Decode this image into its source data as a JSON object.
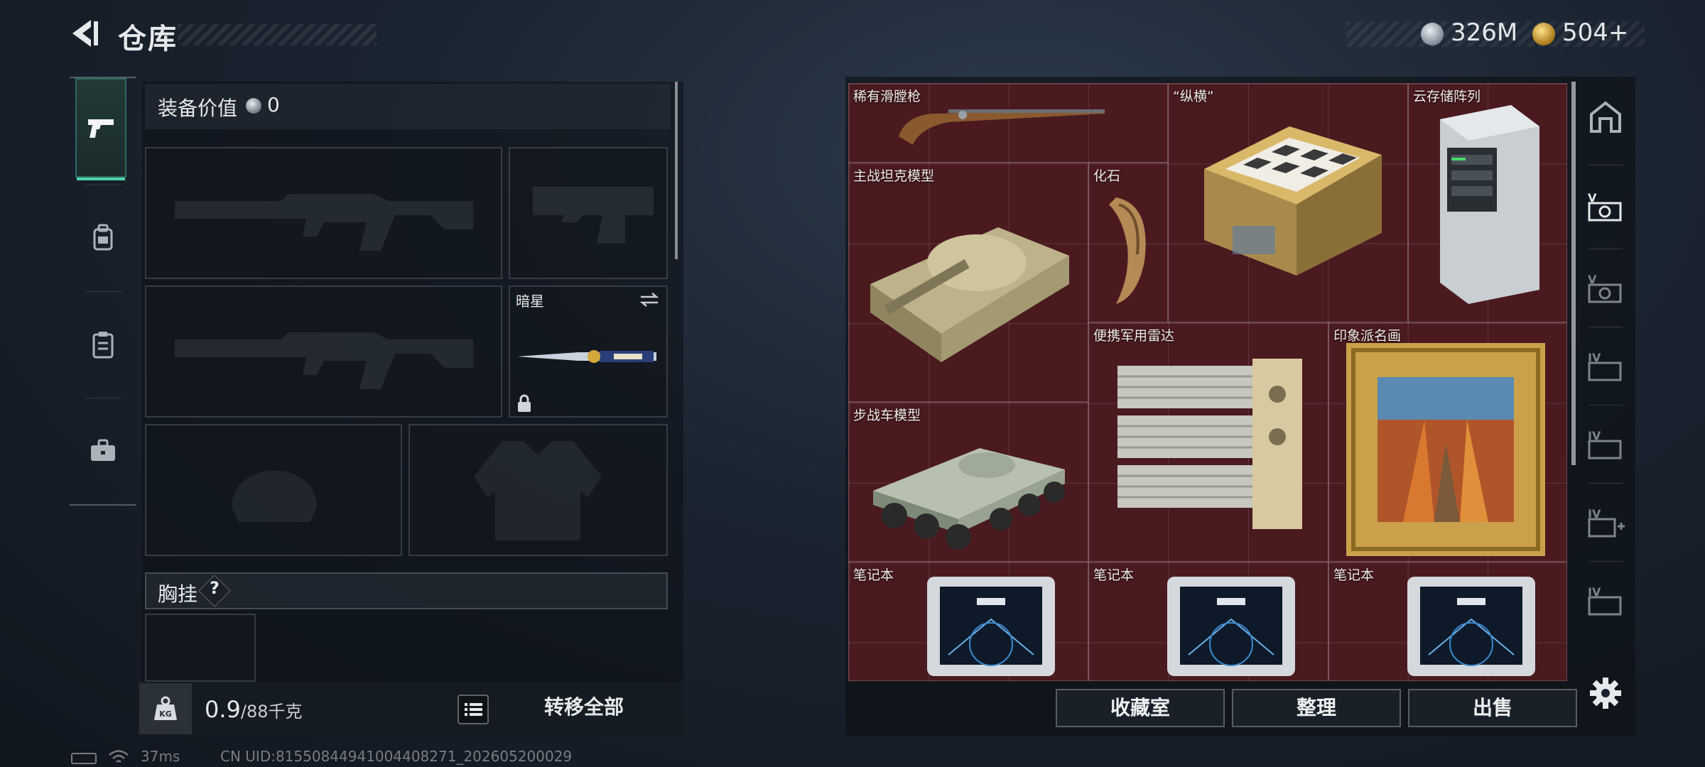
{
  "header": {
    "title": "仓库",
    "currency_silver": "326M",
    "currency_gold": "504+"
  },
  "left_nav": {
    "items": [
      {
        "icon": "pistol-icon",
        "active": true
      },
      {
        "icon": "backpack-icon",
        "active": false
      },
      {
        "icon": "clipboard-icon",
        "active": false
      },
      {
        "icon": "briefcase-icon",
        "active": false
      }
    ]
  },
  "equipment": {
    "label": "装备价值",
    "value": "0",
    "knife_slot_name": "暗星",
    "chest_label": "胸挂",
    "chest_help": "?"
  },
  "bottom_left": {
    "weight_value": "0.9",
    "weight_capacity": "/88千克",
    "transfer_all": "转移全部"
  },
  "stash": {
    "items": [
      {
        "name": "稀有滑膛枪",
        "icon": "musket-icon"
      },
      {
        "name": "“纵横”",
        "icon": "chessboard-icon"
      },
      {
        "name": "云存储阵列",
        "icon": "server-tower-icon"
      },
      {
        "name": "主战坦克模型",
        "icon": "tank-icon"
      },
      {
        "name": "化石",
        "icon": "fossil-claw-icon"
      },
      {
        "name": "便携军用雷达",
        "icon": "radar-icon"
      },
      {
        "name": "印象派名画",
        "icon": "painting-icon"
      },
      {
        "name": "步战车模型",
        "icon": "ifv-icon"
      },
      {
        "name": "笔记本",
        "icon": "laptop-icon"
      },
      {
        "name": "笔记本",
        "icon": "laptop-icon"
      },
      {
        "name": "笔记本",
        "icon": "laptop-icon"
      }
    ]
  },
  "right_nav": {
    "items": [
      {
        "icon": "home-icon"
      },
      {
        "icon": "stash-v-icon"
      },
      {
        "icon": "stash-v-icon"
      },
      {
        "icon": "stash-iv-icon"
      },
      {
        "icon": "stash-iv-icon"
      },
      {
        "icon": "stash-iv-add-icon"
      },
      {
        "icon": "stash-iv-icon"
      }
    ]
  },
  "bottom_right": {
    "collection_room": "收藏室",
    "organize": "整理",
    "sell": "出售"
  },
  "footer": {
    "ping": "37ms",
    "uid": "CN UID:81550844941004408271_202605200029"
  },
  "colors": {
    "accent_green": "#4fd2a8",
    "stash_bg": "#4a1a1f"
  }
}
